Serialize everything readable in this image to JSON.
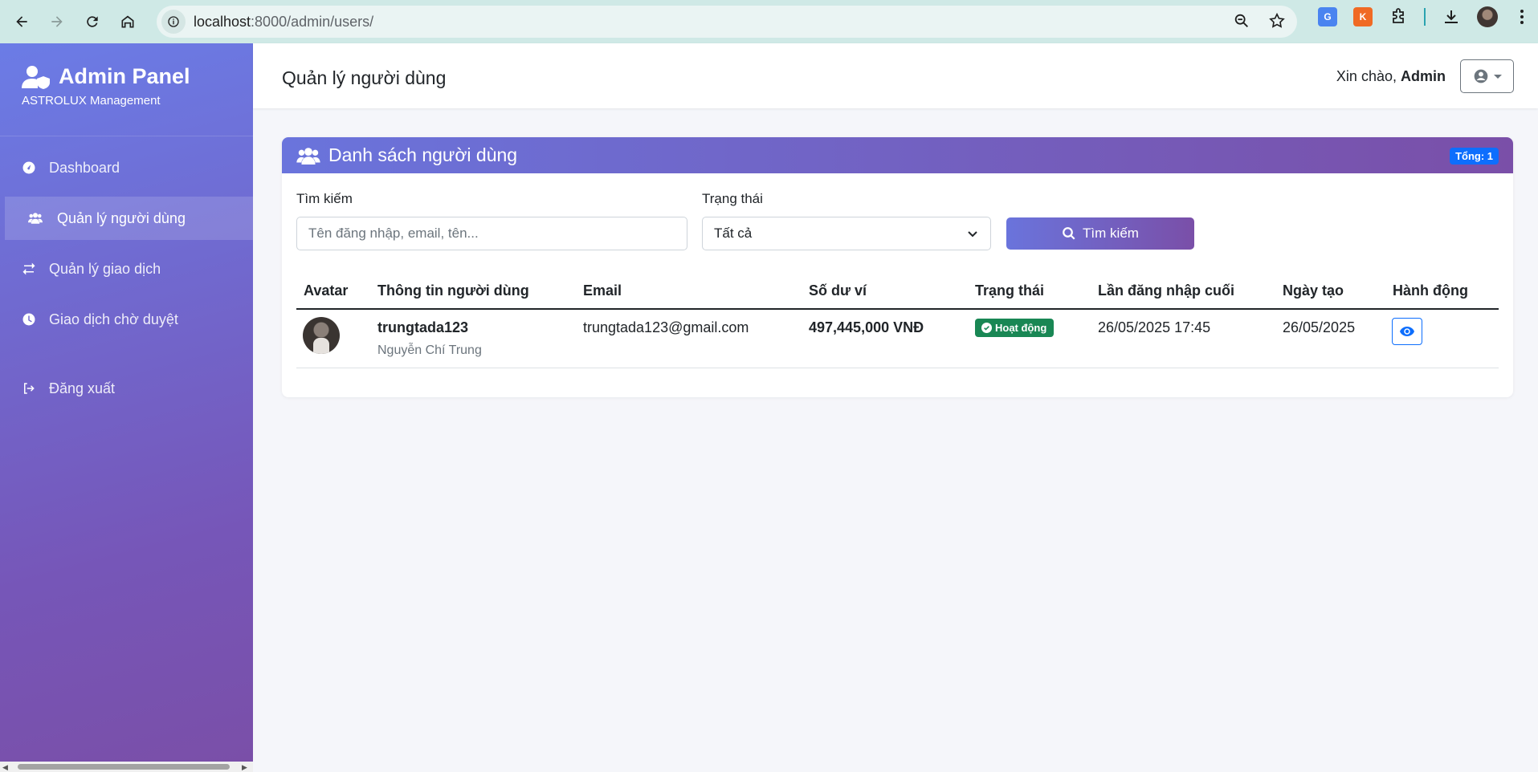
{
  "browser": {
    "url_host": "localhost",
    "url_rest": ":8000/admin/users/"
  },
  "sidebar": {
    "brand_title": "Admin Panel",
    "brand_sub": "ASTROLUX Management",
    "items": [
      {
        "label": "Dashboard",
        "icon": "gauge-icon"
      },
      {
        "label": "Quản lý người dùng",
        "icon": "users-icon",
        "active": true
      },
      {
        "label": "Quản lý giao dịch",
        "icon": "exchange-icon"
      },
      {
        "label": "Giao dịch chờ duyệt",
        "icon": "clock-icon"
      },
      {
        "label": "Đăng xuất",
        "icon": "sign-out-icon"
      }
    ]
  },
  "topbar": {
    "title": "Quản lý người dùng",
    "greeting": "Xin chào,",
    "username": "Admin"
  },
  "card": {
    "title": "Danh sách người dùng",
    "total_badge": "Tổng: 1",
    "search_label": "Tìm kiếm",
    "search_placeholder": "Tên đăng nhập, email, tên...",
    "status_label": "Trạng thái",
    "status_value": "Tất cả",
    "search_button": "Tìm kiếm"
  },
  "table": {
    "headers": [
      "Avatar",
      "Thông tin người dùng",
      "Email",
      "Số dư ví",
      "Trạng thái",
      "Lần đăng nhập cuối",
      "Ngày tạo",
      "Hành động"
    ],
    "rows": [
      {
        "username": "trungtada123",
        "fullname": "Nguyễn Chí Trung",
        "email": "trungtada123@gmail.com",
        "balance": "497,445,000 VNĐ",
        "status": "Hoạt động",
        "last_login": "26/05/2025 17:45",
        "created": "26/05/2025"
      }
    ]
  },
  "colors": {
    "sidebar_top": "#6b7ce6",
    "sidebar_bottom": "#7a4fa8",
    "badge_blue": "#0d6efd",
    "status_green": "#198754"
  }
}
